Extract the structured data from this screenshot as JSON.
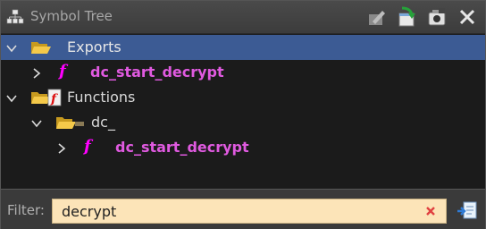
{
  "window": {
    "title": "Symbol Tree"
  },
  "toolbar": {
    "buttons": [
      "edit-icon",
      "navigate-icon",
      "snapshot-icon",
      "close-icon"
    ]
  },
  "tree": {
    "rows": [
      {
        "label": "Exports",
        "type": "folder",
        "expanded": true,
        "selected": true
      },
      {
        "label": "dc_start_decrypt",
        "type": "function",
        "expanded": false
      },
      {
        "label": "Functions",
        "type": "folder",
        "expanded": true
      },
      {
        "label": "dc_",
        "type": "namespace",
        "expanded": true
      },
      {
        "label": "dc_start_decrypt",
        "type": "function",
        "expanded": false
      }
    ],
    "function_glyph": "f"
  },
  "filter": {
    "label": "Filter:",
    "value": "decrypt"
  },
  "colors": {
    "selection": "#3c5b94",
    "function_text": "#e05ae0",
    "filter_bg": "#fce4b8"
  }
}
